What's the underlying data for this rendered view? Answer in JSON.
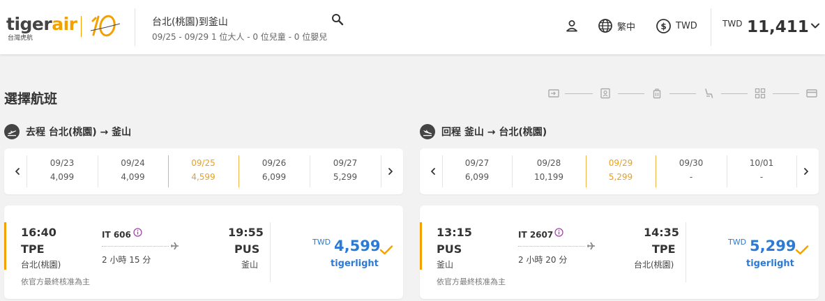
{
  "header": {
    "logo_text_main": "tiger",
    "logo_text_accent": "air",
    "logo_sub": "台灣虎航",
    "route_title": "台北(桃園)到釜山",
    "route_sub": "09/25 - 09/29   1 位大人 - 0 位兒童 - 0 位嬰兒",
    "language_label": "繁中",
    "currency_label": "TWD",
    "total_currency": "TWD",
    "total_amount": "11,411"
  },
  "page_title": "選擇航班",
  "outbound": {
    "leg_label": "去程  台北(桃園) → 釜山",
    "dates": [
      {
        "date": "09/23",
        "price": "4,099"
      },
      {
        "date": "09/24",
        "price": "4,099"
      },
      {
        "date": "09/25",
        "price": "4,599",
        "selected": true
      },
      {
        "date": "09/26",
        "price": "6,099"
      },
      {
        "date": "09/27",
        "price": "5,299"
      }
    ],
    "flight": {
      "depart_time": "16:40",
      "depart_code": "TPE",
      "depart_city": "台北(桃園)",
      "flight_no": "IT 606",
      "duration": "2 小時 15 分",
      "arrive_time": "19:55",
      "arrive_code": "PUS",
      "arrive_city": "釜山",
      "currency": "TWD",
      "price": "4,599",
      "fare": "tigerlight",
      "disclaimer": "依官方最終核准為主"
    }
  },
  "inbound": {
    "leg_label": "回程  釜山 → 台北(桃園)",
    "dates": [
      {
        "date": "09/27",
        "price": "6,099"
      },
      {
        "date": "09/28",
        "price": "10,199"
      },
      {
        "date": "09/29",
        "price": "5,299",
        "selected": true
      },
      {
        "date": "09/30",
        "price": "-"
      },
      {
        "date": "10/01",
        "price": "-"
      }
    ],
    "flight": {
      "depart_time": "13:15",
      "depart_code": "PUS",
      "depart_city": "釜山",
      "flight_no": "IT 2607",
      "duration": "2 小時 20 分",
      "arrive_time": "14:35",
      "arrive_code": "TPE",
      "arrive_city": "台北(桃園)",
      "currency": "TWD",
      "price": "5,299",
      "fare": "tigerlight",
      "disclaimer": "依官方最終核准為主"
    }
  },
  "colors": {
    "brand": "#f2a100",
    "selected": "#e9a020",
    "price": "#2a7ad6",
    "background": "#f2f2f2"
  },
  "icons": {
    "search": "search-icon",
    "account": "user-icon",
    "language": "globe-icon",
    "currency": "dollar-icon",
    "expand": "chevron-down-icon",
    "steps": [
      "ticket-icon",
      "passenger-icon",
      "baggage-icon",
      "seat-icon",
      "addons-icon",
      "payment-icon"
    ]
  }
}
